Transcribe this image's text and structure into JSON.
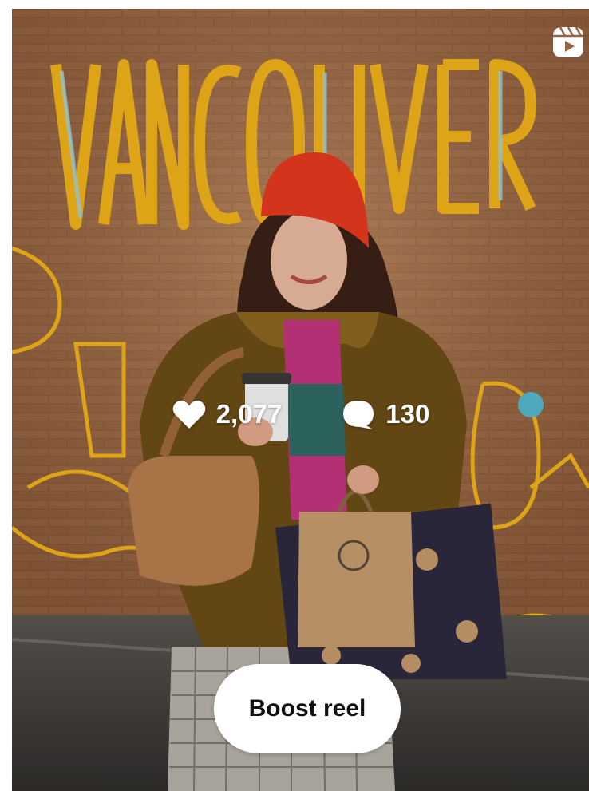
{
  "post": {
    "likes": "2,077",
    "comments": "130"
  },
  "actions": {
    "boost_label": "Boost reel"
  },
  "icons": {
    "like": "heart-icon",
    "comment": "comment-bubble-icon",
    "media_type": "reels-icon"
  },
  "colors": {
    "overlay_text": "#ffffff",
    "button_bg": "#ffffff",
    "button_text": "#111111"
  }
}
